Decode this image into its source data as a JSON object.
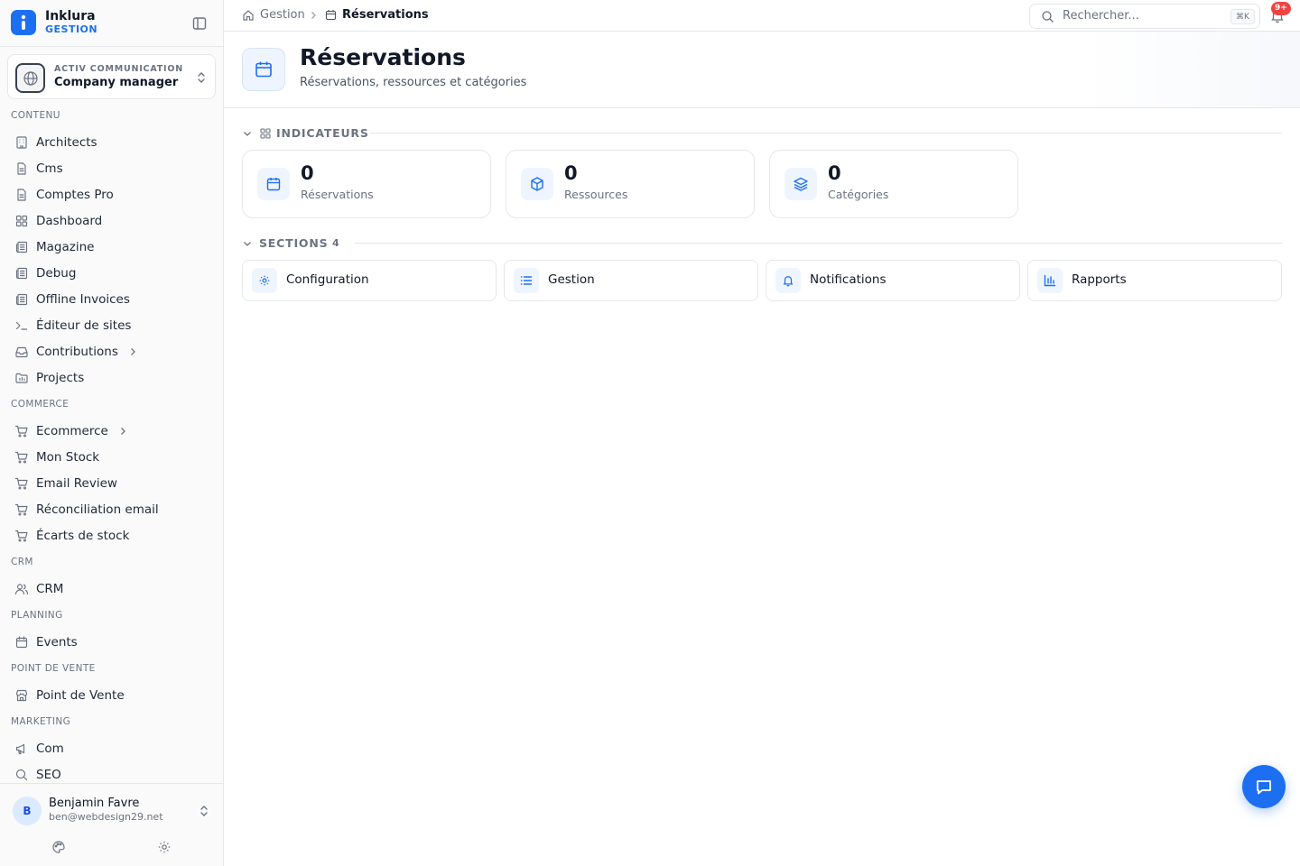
{
  "app": {
    "name": "Inklura",
    "module": "GESTION"
  },
  "company": {
    "name": "ACTIV COMMUNICATION",
    "role": "Company manager"
  },
  "sidebar": {
    "sections": [
      {
        "title": "CONTENU",
        "items": [
          {
            "label": "Architects",
            "icon": "building-icon"
          },
          {
            "label": "Cms",
            "icon": "file-icon"
          },
          {
            "label": "Comptes Pro",
            "icon": "file-icon"
          },
          {
            "label": "Dashboard",
            "icon": "layout-grid-icon"
          },
          {
            "label": "Magazine",
            "icon": "newspaper-icon"
          },
          {
            "label": "Debug",
            "icon": "newspaper-icon"
          },
          {
            "label": "Offline Invoices",
            "icon": "newspaper-icon"
          },
          {
            "label": "Éditeur de sites",
            "icon": "terminal-icon"
          },
          {
            "label": "Contributions",
            "icon": "inbox-icon",
            "has_children": true
          },
          {
            "label": "Projects",
            "icon": "folder-icon"
          }
        ]
      },
      {
        "title": "COMMERCE",
        "items": [
          {
            "label": "Ecommerce",
            "icon": "cart-icon",
            "has_children": true
          },
          {
            "label": "Mon Stock",
            "icon": "cart-icon"
          },
          {
            "label": "Email Review",
            "icon": "cart-icon"
          },
          {
            "label": "Réconciliation email",
            "icon": "cart-icon"
          },
          {
            "label": "Écarts de stock",
            "icon": "cart-icon"
          }
        ]
      },
      {
        "title": "CRM",
        "items": [
          {
            "label": "CRM",
            "icon": "users-icon"
          }
        ]
      },
      {
        "title": "PLANNING",
        "items": [
          {
            "label": "Events",
            "icon": "calendar-icon"
          }
        ]
      },
      {
        "title": "POINT DE VENTE",
        "items": [
          {
            "label": "Point de Vente",
            "icon": "store-icon"
          }
        ]
      },
      {
        "title": "MARKETING",
        "items": [
          {
            "label": "Com",
            "icon": "megaphone-icon"
          },
          {
            "label": "SEO",
            "icon": "search-icon"
          }
        ]
      }
    ]
  },
  "user": {
    "initial": "B",
    "name": "Benjamin Favre",
    "email": "ben@webdesign29.net"
  },
  "topbar": {
    "breadcrumb": [
      "Gestion",
      "Réservations"
    ],
    "search_placeholder": "Rechercher...",
    "search_shortcut": "⌘K",
    "notifications_badge": "9+"
  },
  "page": {
    "title": "Réservations",
    "subtitle": "Réservations, ressources et catégories"
  },
  "indicators": {
    "heading": "INDICATEURS",
    "cards": [
      {
        "value": "0",
        "label": "Réservations",
        "icon": "calendar-icon"
      },
      {
        "value": "0",
        "label": "Ressources",
        "icon": "box-icon"
      },
      {
        "value": "0",
        "label": "Catégories",
        "icon": "layers-icon"
      }
    ]
  },
  "sections": {
    "heading": "SECTIONS",
    "count": "4",
    "cards": [
      {
        "label": "Configuration",
        "icon": "gear-icon"
      },
      {
        "label": "Gestion",
        "icon": "list-icon"
      },
      {
        "label": "Notifications",
        "icon": "bell-icon"
      },
      {
        "label": "Rapports",
        "icon": "bar-chart-icon"
      }
    ]
  },
  "colors": {
    "accent": "#1d6ff2",
    "badge": "#ef4444",
    "border": "#e5e7eb",
    "muted": "#6b7280"
  }
}
